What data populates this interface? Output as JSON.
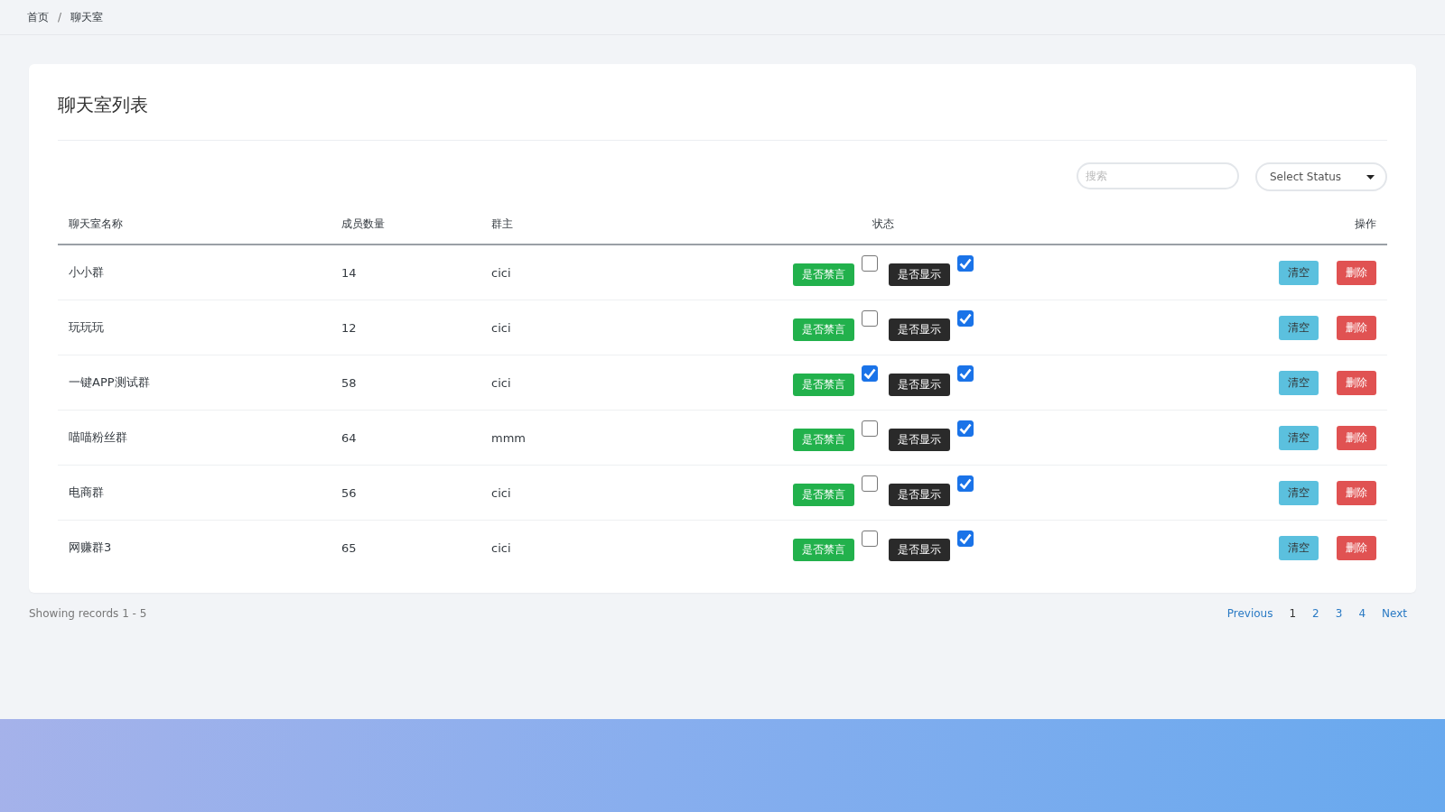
{
  "breadcrumb": [
    {
      "label": "首页"
    },
    {
      "label": "聊天室"
    }
  ],
  "breadcrumb_separator": "/",
  "card": {
    "title": "聊天室列表"
  },
  "search": {
    "placeholder": "搜索"
  },
  "status_select": {
    "value": "Select Status"
  },
  "table": {
    "columns": [
      "聊天室名称",
      "成员数量",
      "群主",
      "状态",
      "操作"
    ],
    "rows": [
      {
        "name": "小小群",
        "members": "14",
        "owner": "cici",
        "mute_label": "是否禁言",
        "muted": false,
        "show_label": "是否显示",
        "shown": true,
        "clear": "清空",
        "delete": "删除"
      },
      {
        "name": "玩玩玩",
        "members": "12",
        "owner": "cici",
        "mute_label": "是否禁言",
        "muted": false,
        "show_label": "是否显示",
        "shown": true,
        "clear": "清空",
        "delete": "删除"
      },
      {
        "name": "一键APP测试群",
        "members": "58",
        "owner": "cici",
        "mute_label": "是否禁言",
        "muted": true,
        "show_label": "是否显示",
        "shown": true,
        "clear": "清空",
        "delete": "删除"
      },
      {
        "name": "喵喵粉丝群",
        "members": "64",
        "owner": "mmm",
        "mute_label": "是否禁言",
        "muted": false,
        "show_label": "是否显示",
        "shown": true,
        "clear": "清空",
        "delete": "删除"
      },
      {
        "name": "电商群",
        "members": "56",
        "owner": "cici",
        "mute_label": "是否禁言",
        "muted": false,
        "show_label": "是否显示",
        "shown": true,
        "clear": "清空",
        "delete": "删除"
      },
      {
        "name": "网赚群3",
        "members": "65",
        "owner": "cici",
        "mute_label": "是否禁言",
        "muted": false,
        "show_label": "是否显示",
        "shown": true,
        "clear": "清空",
        "delete": "删除"
      }
    ]
  },
  "records_info": "Showing records 1 - 5",
  "pagination": {
    "previous": "Previous",
    "next": "Next",
    "pages": [
      {
        "label": "1",
        "selected": true
      },
      {
        "label": "2",
        "selected": false
      },
      {
        "label": "3",
        "selected": false
      },
      {
        "label": "4",
        "selected": false
      }
    ]
  }
}
